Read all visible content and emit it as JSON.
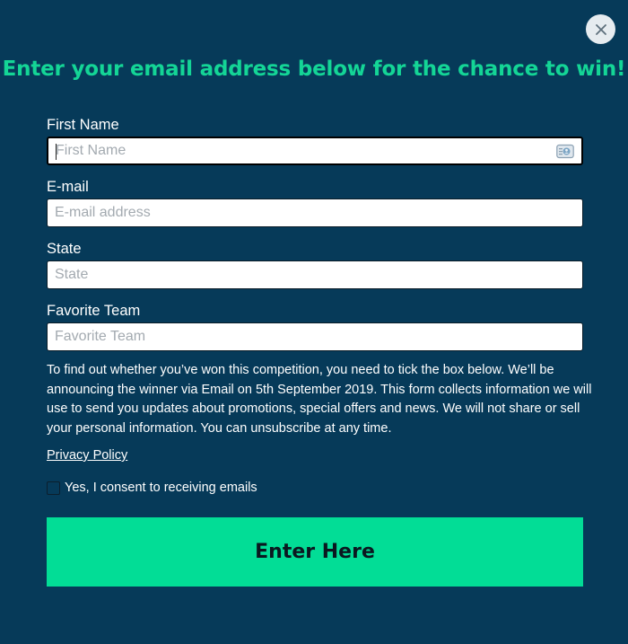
{
  "modal": {
    "close_icon": "close-icon",
    "headline": "Enter your email address below for the chance to win!"
  },
  "form": {
    "fields": [
      {
        "label": "First Name",
        "placeholder": "First Name",
        "value": "",
        "focused": true,
        "autofill_icon": "contact-card-icon"
      },
      {
        "label": "E-mail",
        "placeholder": "E-mail address",
        "value": ""
      },
      {
        "label": "State",
        "placeholder": "State",
        "value": ""
      },
      {
        "label": "Favorite Team",
        "placeholder": "Favorite Team",
        "value": ""
      }
    ],
    "disclaimer": "To find out whether you’ve won this competition, you need to tick the box below. We’ll be announcing the winner via Email on 5th September 2019. This form collects information we will use to send you updates about promotions, special offers and news. We will not share or sell your personal information. You can unsubscribe at any time.",
    "privacy_link": "Privacy Policy",
    "consent": {
      "label": "Yes, I consent to receiving emails",
      "checked": false
    },
    "submit_label": "Enter Here"
  },
  "colors": {
    "background": "#063a59",
    "headline": "#14d596",
    "button": "#02dd96",
    "close_button_bg": "#e6ecf0"
  }
}
